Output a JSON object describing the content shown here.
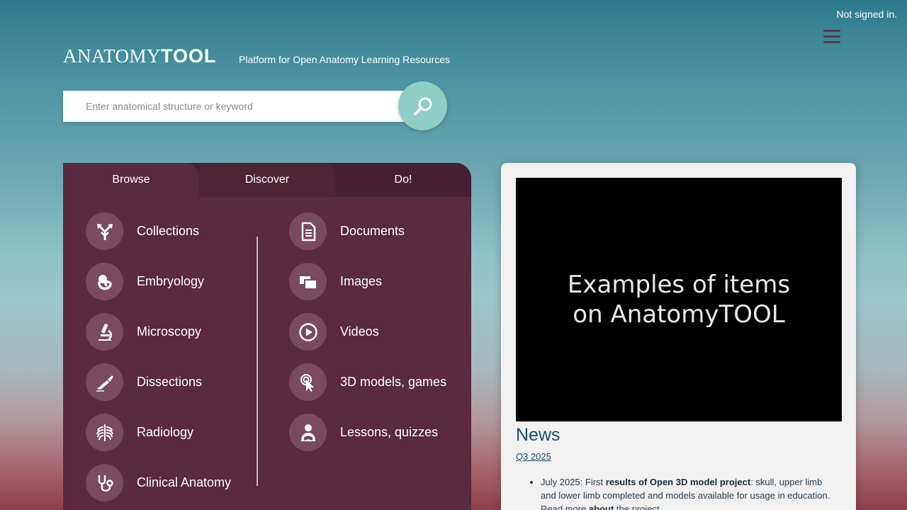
{
  "header": {
    "signin_status": "Not signed in.",
    "logo_light": "ANATOMY",
    "logo_bold": "TOOL",
    "tagline": "Platform for Open Anatomy Learning Resources"
  },
  "search": {
    "placeholder": "Enter anatomical structure or keyword"
  },
  "tabs": [
    {
      "label": "Browse"
    },
    {
      "label": "Discover"
    },
    {
      "label": "Do!"
    }
  ],
  "browse": {
    "left": [
      {
        "label": "Collections",
        "icon": "arrows-split-icon"
      },
      {
        "label": "Embryology",
        "icon": "embryo-icon"
      },
      {
        "label": "Microscopy",
        "icon": "microscope-icon"
      },
      {
        "label": "Dissections",
        "icon": "scalpel-icon"
      },
      {
        "label": "Radiology",
        "icon": "ribcage-icon"
      },
      {
        "label": "Clinical Anatomy",
        "icon": "stethoscope-icon"
      }
    ],
    "right": [
      {
        "label": "Documents",
        "icon": "document-icon"
      },
      {
        "label": "Images",
        "icon": "images-icon"
      },
      {
        "label": "Videos",
        "icon": "play-icon"
      },
      {
        "label": "3D models, games",
        "icon": "pointer-click-icon"
      },
      {
        "label": "Lessons, quizzes",
        "icon": "student-icon"
      }
    ]
  },
  "media": {
    "video_text": "Examples of items on AnatomyTOOL"
  },
  "news": {
    "title": "News",
    "period_link": "Q3 2025",
    "item1_prefix": "July 2025: First ",
    "item1_bold": "results of Open 3D model project",
    "item1_mid": ": skull, upper limb and lower limb completed and models available for usage in education. Read more ",
    "item1_bold2": "about",
    "item1_suffix": " the project."
  },
  "colors": {
    "panel": "#5a2a3e",
    "icon_circle": "#7a4a5e",
    "search_button": "#8fcfc3",
    "news_title": "#1e4e68"
  }
}
